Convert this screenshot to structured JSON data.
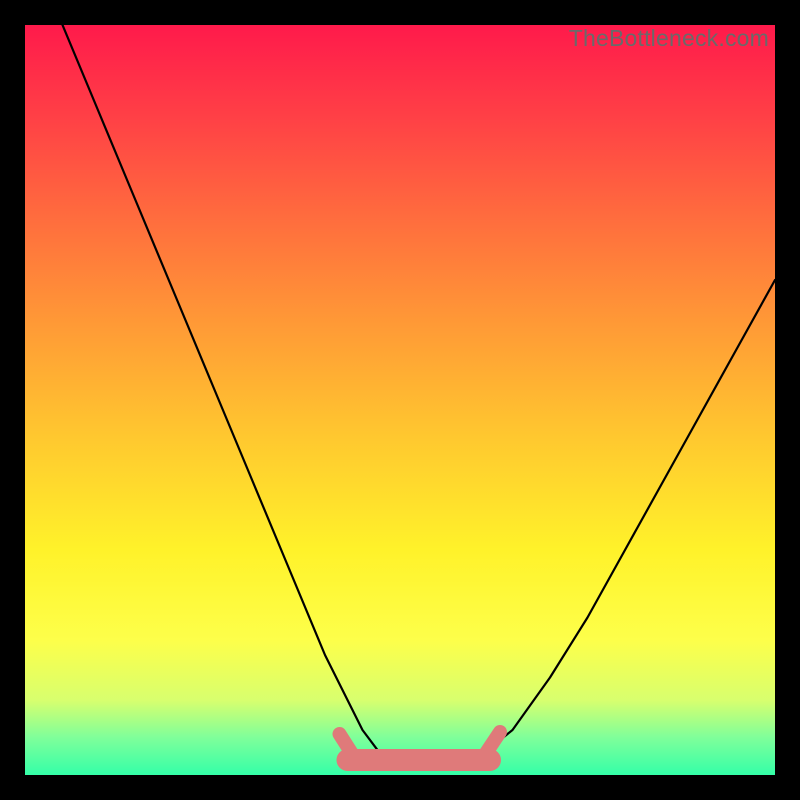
{
  "watermark": "TheBottleneck.com",
  "chart_data": {
    "type": "line",
    "title": "",
    "xlabel": "",
    "ylabel": "",
    "xlim": [
      0,
      100
    ],
    "ylim": [
      0,
      100
    ],
    "series": [
      {
        "name": "bottleneck-curve",
        "x": [
          5,
          10,
          15,
          20,
          25,
          30,
          35,
          40,
          45,
          48,
          50,
          52,
          55,
          58,
          60,
          65,
          70,
          75,
          80,
          85,
          90,
          95,
          100
        ],
        "y": [
          100,
          88,
          76,
          64,
          52,
          40,
          28,
          16,
          6,
          2,
          1,
          1,
          1,
          1,
          2,
          6,
          13,
          21,
          30,
          39,
          48,
          57,
          66
        ]
      }
    ],
    "highlight_band": {
      "name": "optimal-range",
      "x_start": 43,
      "x_end": 62,
      "y": 2
    },
    "colors": {
      "background_gradient_top": "#ff1a4b",
      "background_gradient_bottom": "#34ffa8",
      "curve": "#000000",
      "highlight": "#df7a7a",
      "frame": "#000000"
    }
  }
}
